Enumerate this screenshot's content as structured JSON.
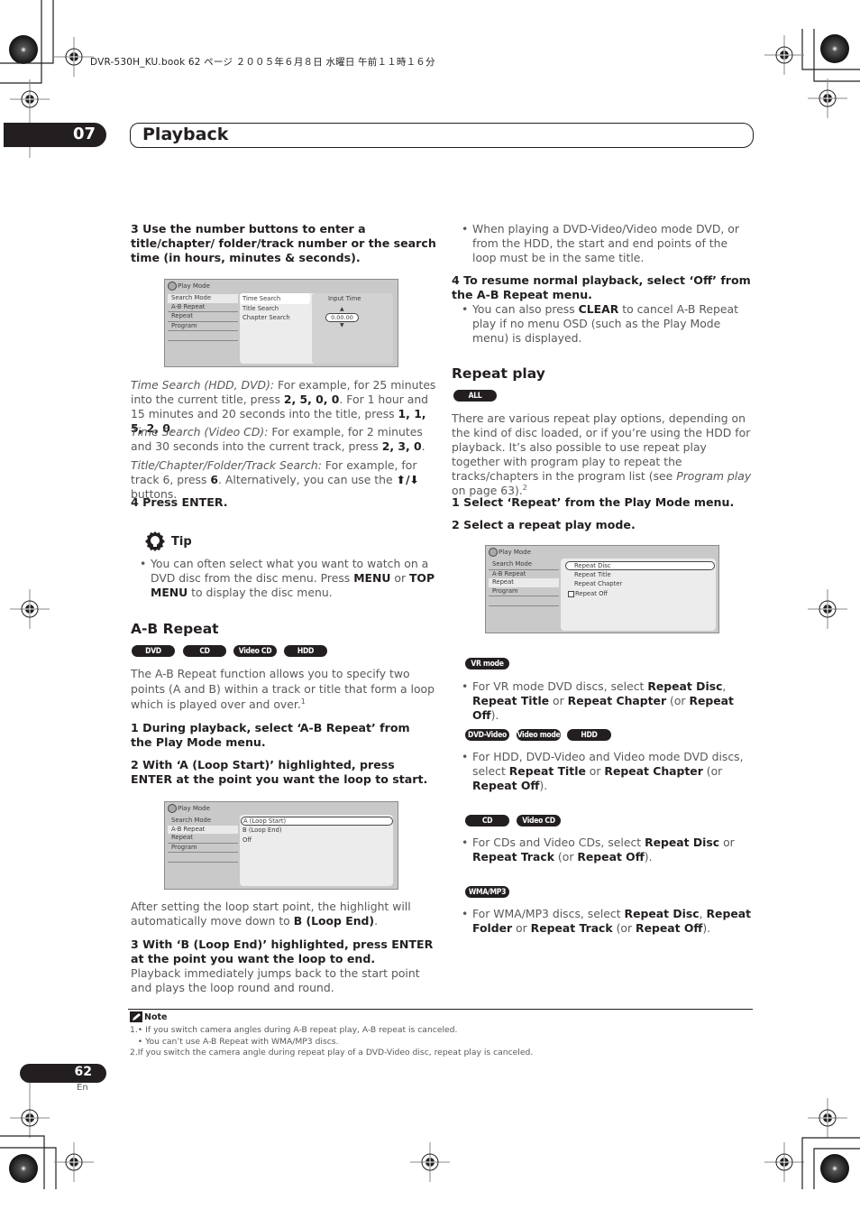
{
  "print_header": "DVR-530H_KU.book  62 ページ  ２００５年６月８日  水曜日  午前１１時１６分",
  "chapter": {
    "number": "07",
    "title": "Playback"
  },
  "left": {
    "step3": "3    Use the number buttons to enter a title/chapter/ folder/track number or the search time (in hours, minutes & seconds).",
    "osd1": {
      "title": "Play Mode",
      "menu": [
        "Search Mode",
        "A-B Repeat",
        "Repeat",
        "Program"
      ],
      "options": [
        "Time Search",
        "Title Search",
        "Chapter Search"
      ],
      "input_label": "Input Time",
      "input_value": "0.00.00"
    },
    "time_search_hdd_label": "Time Search (HDD, DVD):",
    "time_search_hdd_text1": " For example, for 25 minutes into the current title, press ",
    "time_search_hdd_keys1": "2, 5, 0, 0",
    "time_search_hdd_text2": ". For 1 hour and 15 minutes and 20 seconds into the title, press ",
    "time_search_hdd_keys2": "1, 1, 5, 2, 0",
    "time_search_vcd_label": "Time Search (Video CD):",
    "time_search_vcd_text": " For example, for 2 minutes and 30 seconds into the current track, press ",
    "time_search_vcd_keys": "2, 3, 0",
    "track_search_label": "Title/Chapter/Folder/Track Search:",
    "track_search_text1": " For example, for track 6, press ",
    "track_search_key": "6",
    "track_search_text2": ". Alternatively, you can use the ",
    "track_search_arrows": "⬆/⬇",
    "track_search_text3": " buttons.",
    "step4": "4    Press ENTER.",
    "tip": {
      "label": "Tip",
      "text1": "You can often select what you want to watch on a DVD disc from the disc menu. Press ",
      "key1": "MENU",
      "text2": " or ",
      "key2": "TOP MENU",
      "text3": " to display the disc menu."
    },
    "ab_heading": "A-B Repeat",
    "ab_pills": [
      "DVD",
      "CD",
      "Video CD",
      "HDD"
    ],
    "ab_intro": "The A-B Repeat function allows you to specify two points (A and B) within a track or title that form a loop which is played over and over.",
    "ab_intro_sup": "1",
    "ab_step1": "1    During playback, select ‘A-B Repeat’ from the Play Mode menu.",
    "ab_step2": "2    With ‘A (Loop Start)’ highlighted, press ENTER at the point you want the loop to start.",
    "osd2": {
      "title": "Play Mode",
      "menu": [
        "Search Mode",
        "A-B Repeat",
        "Repeat",
        "Program"
      ],
      "options": [
        "A (Loop Start)",
        "B (Loop End)",
        "Off"
      ]
    },
    "after_text": "After setting the loop start point, the highlight will automatically move down to ",
    "after_key": "B (Loop End)",
    "ab_step3": "3    With ‘B (Loop End)’ highlighted, press ENTER at the point you want the loop to end.",
    "ab_step3_text": "Playback immediately jumps back to the start point and plays the loop round and round."
  },
  "right": {
    "bullet_loop": "When playing a DVD-Video/Video mode DVD, or from the HDD, the start and end points of the loop must be in the same title.",
    "step4": "4    To resume normal playback, select ‘Off’ from the A-B Repeat menu.",
    "clear_text1": "You can also press ",
    "clear_key": "CLEAR",
    "clear_text2": " to cancel A-B Repeat play if no menu OSD (such as the Play Mode menu) is displayed.",
    "repeat_heading": "Repeat play",
    "repeat_pill": "ALL",
    "repeat_intro1": "There are various repeat play options, depending on the kind of disc loaded, or if you’re using the HDD for playback. It’s also possible to use repeat play together with program play to repeat the tracks/chapters in the program list (see ",
    "repeat_intro_link": "Program play",
    "repeat_intro2": " on page 63).",
    "repeat_intro_sup": "2",
    "step1": "1    Select ‘Repeat’ from the Play Mode menu.",
    "step2": "2    Select a repeat play mode.",
    "osd3": {
      "title": "Play Mode",
      "menu": [
        "Search Mode",
        "A-B Repeat",
        "Repeat",
        "Program"
      ],
      "options": [
        "Repeat Disc",
        "Repeat Title",
        "Repeat Chapter",
        "Repeat Off"
      ]
    },
    "vr_pill": "VR mode",
    "vr_t1": "For VR mode DVD discs, select ",
    "vr_k1": "Repeat Disc",
    "vr_t2": ", ",
    "vr_k2": "Repeat Title",
    "vr_t3": " or ",
    "vr_k3": "Repeat Chapter",
    "vr_t4": " (or ",
    "vr_k4": "Repeat Off",
    "vr_t5": ").",
    "dvd_pills": [
      "DVD-Video",
      "Video mode",
      "HDD"
    ],
    "dvd_t1": "For HDD, DVD-Video and Video mode DVD discs, select ",
    "dvd_k1": "Repeat Title",
    "dvd_t2": " or ",
    "dvd_k2": "Repeat Chapter",
    "dvd_t3": " (or ",
    "dvd_k3": "Repeat Off",
    "dvd_t4": ").",
    "cd_pills": [
      "CD",
      "Video CD"
    ],
    "cd_t1": "For CDs and Video CDs, select ",
    "cd_k1": "Repeat Disc",
    "cd_t2": " or ",
    "cd_k2": "Repeat Track",
    "cd_t3": " (or ",
    "cd_k3": "Repeat Off",
    "cd_t4": ").",
    "wma_pill": "WMA/MP3",
    "wma_t1": "For WMA/MP3 discs, select ",
    "wma_k1": "Repeat Disc",
    "wma_t2": ", ",
    "wma_k2": "Repeat Folder",
    "wma_t3": " or ",
    "wma_k3": "Repeat Track",
    "wma_t4": " (or ",
    "wma_k4": "Repeat Off",
    "wma_t5": ")."
  },
  "note": {
    "label": "Note",
    "lines": [
      "1.• If you switch camera angles during A-B repeat play, A-B repeat is canceled.",
      "   • You can’t use A-B Repeat with WMA/MP3 discs.",
      "2.If you switch the camera angle during repeat play of a DVD-Video disc, repeat play is canceled."
    ]
  },
  "page": {
    "number": "62",
    "lang": "En"
  }
}
